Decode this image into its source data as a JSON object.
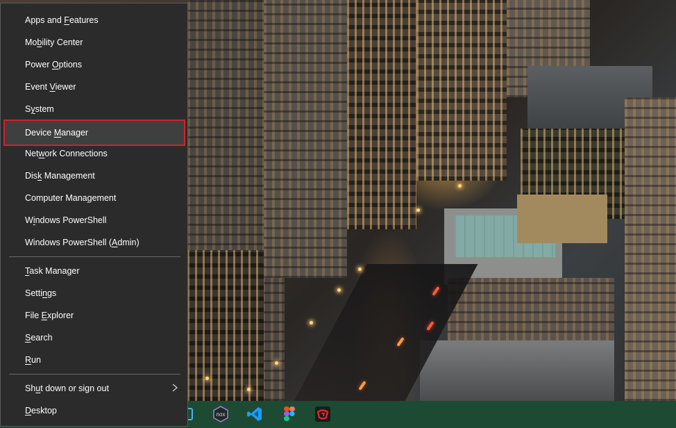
{
  "menu": {
    "items": [
      {
        "pre": "Apps and ",
        "key": "F",
        "post": "eatures"
      },
      {
        "pre": "Mo",
        "key": "b",
        "post": "ility Center"
      },
      {
        "pre": "Power ",
        "key": "O",
        "post": "ptions"
      },
      {
        "pre": "Event ",
        "key": "V",
        "post": "iewer"
      },
      {
        "pre": "S",
        "key": "y",
        "post": "stem"
      },
      {
        "pre": "Device ",
        "key": "M",
        "post": "anager"
      },
      {
        "pre": "Net",
        "key": "w",
        "post": "ork Connections"
      },
      {
        "pre": "Dis",
        "key": "k",
        "post": " Management"
      },
      {
        "pre": "Computer Mana",
        "key": "g",
        "post": "ement"
      },
      {
        "pre": "W",
        "key": "i",
        "post": "ndows PowerShell"
      },
      {
        "pre": "Windows PowerShell (",
        "key": "A",
        "post": "dmin)"
      },
      {
        "pre": "",
        "key": "T",
        "post": "ask Manager"
      },
      {
        "pre": "Setti",
        "key": "n",
        "post": "gs"
      },
      {
        "pre": "File ",
        "key": "E",
        "post": "xplorer"
      },
      {
        "pre": "",
        "key": "S",
        "post": "earch"
      },
      {
        "pre": "",
        "key": "R",
        "post": "un"
      },
      {
        "pre": "Sh",
        "key": "u",
        "post": "t down or sign out"
      },
      {
        "pre": "",
        "key": "D",
        "post": "esktop"
      }
    ],
    "highlight_color": "#d6212b"
  },
  "taskbar": {
    "color": "#1d4a33",
    "icons": [
      "partial-app-icon",
      "nox-player-icon",
      "vscode-icon",
      "figma-icon",
      "garena-icon"
    ],
    "nox_label": "nox"
  }
}
